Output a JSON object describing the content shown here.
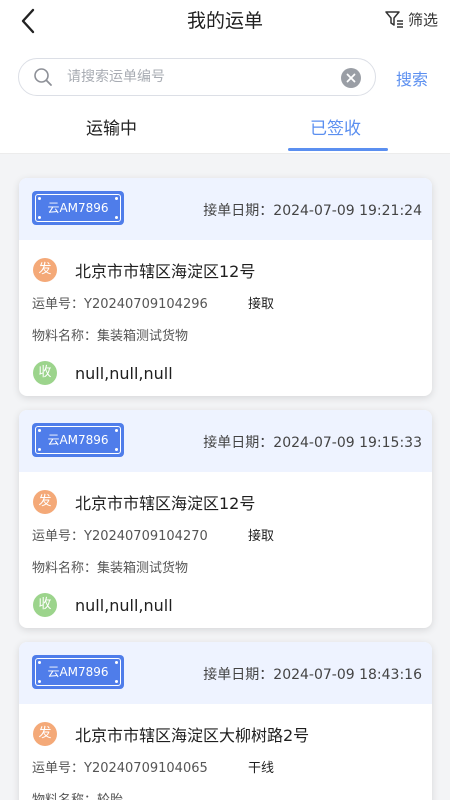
{
  "header": {
    "title": "我的运单",
    "filter_label": "筛选"
  },
  "search": {
    "placeholder": "请搜索运单编号",
    "value": "",
    "button_label": "搜索"
  },
  "tabs": [
    {
      "label": "运输中",
      "active": false
    },
    {
      "label": "已签收",
      "active": true
    }
  ],
  "labels": {
    "date_prefix": "接单日期：",
    "waybill_prefix": "运单号：",
    "material_prefix": "物料名称：",
    "send_badge": "发",
    "recv_badge": "收"
  },
  "colors": {
    "accent": "#5b8ff0",
    "plate": "#4f7dea",
    "send_badge": "#f4a978",
    "recv_badge": "#9cd48c",
    "card_header": "#eef3ff"
  },
  "orders": [
    {
      "plate": "云AM7896",
      "date": "2024-07-09 19:21:24",
      "from": "北京市市辖区海淀区12号",
      "waybill_no": "Y20240709104296",
      "type": "接取",
      "material": "集装箱测试货物",
      "to": "null,null,null"
    },
    {
      "plate": "云AM7896",
      "date": "2024-07-09 19:15:33",
      "from": "北京市市辖区海淀区12号",
      "waybill_no": "Y20240709104270",
      "type": "接取",
      "material": "集装箱测试货物",
      "to": "null,null,null"
    },
    {
      "plate": "云AM7896",
      "date": "2024-07-09 18:43:16",
      "from": "北京市市辖区海淀区大柳树路2号",
      "waybill_no": "Y20240709104065",
      "type": "干线",
      "material": "轮胎",
      "to": ""
    }
  ]
}
